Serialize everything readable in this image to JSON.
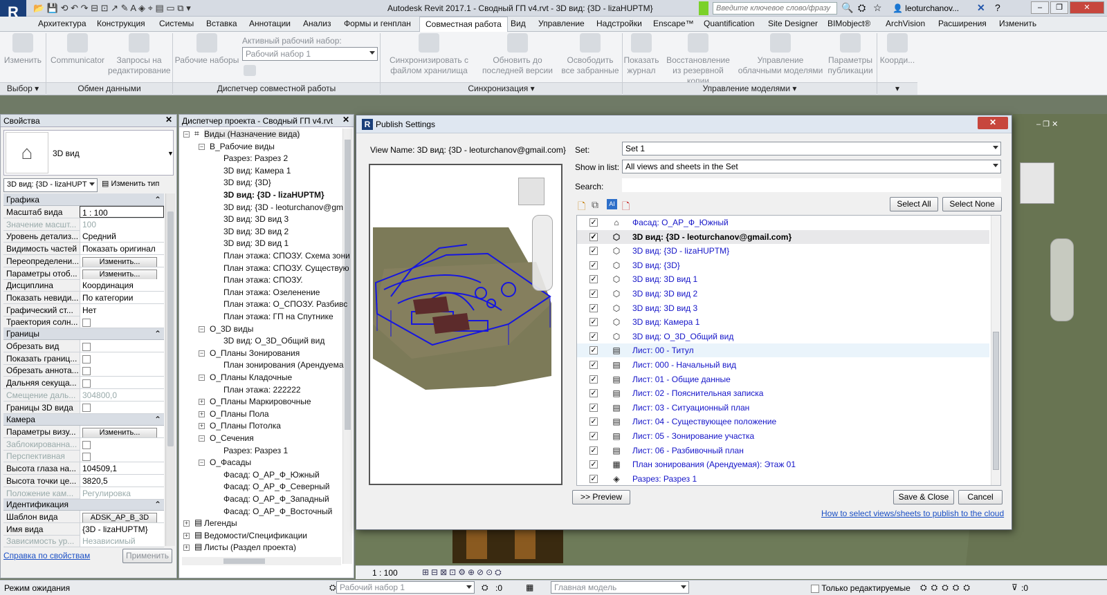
{
  "title_bar": {
    "logo": "R",
    "title": "Autodesk Revit 2017.1 -    Сводный ГП v4.rvt - 3D вид: {3D - lizaHUPTM}",
    "search_placeholder": "Введите ключевое слово/фразу",
    "user": "leoturchanov..."
  },
  "menu_tabs": [
    "Архитектура",
    "Конструкция",
    "Системы",
    "Вставка",
    "Аннотации",
    "Анализ",
    "Формы и генплан",
    "Совместная работа",
    "Вид",
    "Управление",
    "Надстройки",
    "Enscape™",
    "Quantification",
    "Site Designer",
    "BIMobject®",
    "ArchVision",
    "Расширения",
    "Изменить"
  ],
  "active_tab": "Совместная работа",
  "ribbon": {
    "modify": "Изменить",
    "communicator": "Communicator",
    "requests": "Запросы на редактирование",
    "worksets": "Рабочие наборы",
    "active_workset_label": "Активный рабочий набор:",
    "active_workset_value": "Рабочий набор 1",
    "sync": "Синхронизировать с файлом хранилища",
    "reload": "Обновить до последней версии",
    "relinquish": "Освободить все забранные",
    "show_log": "Показать журнал",
    "restore": "Восстановление из резервной копии",
    "cloud_models": "Управление облачными моделями",
    "publish_params": "Параметры публикации",
    "coord": "Коорди...",
    "panel_select": "Выбор",
    "panel_exchange": "Обмен данными",
    "panel_workset_mgr": "Диспетчер совместной работы",
    "panel_sync": "Синхронизация",
    "panel_models": "Управление моделями"
  },
  "properties": {
    "header": "Свойства",
    "type_name": "3D вид",
    "instance_select": "3D вид: {3D - lizaHUPT",
    "edit_type": "Изменить тип",
    "sections": {
      "graphics": "Графика",
      "extents": "Границы",
      "camera": "Камера",
      "identity": "Идентификация"
    },
    "rows_graphics": [
      {
        "k": "Масштаб вида",
        "v": "1 : 100"
      },
      {
        "k": "Значение масшт...",
        "v": "100"
      },
      {
        "k": "Уровень детализ...",
        "v": "Средний"
      },
      {
        "k": "Видимость частей",
        "v": "Показать оригинал"
      },
      {
        "k": "Переопределени...",
        "v": "Изменить..."
      },
      {
        "k": "Параметры отоб...",
        "v": "Изменить..."
      },
      {
        "k": "Дисциплина",
        "v": "Координация"
      },
      {
        "k": "Показать невиди...",
        "v": "По категории"
      },
      {
        "k": "Графический ст...",
        "v": "Нет"
      },
      {
        "k": "Траектория солн...",
        "v": ""
      }
    ],
    "rows_extents": [
      {
        "k": "Обрезать вид",
        "v": ""
      },
      {
        "k": "Показать границ...",
        "v": ""
      },
      {
        "k": "Обрезать аннота...",
        "v": ""
      },
      {
        "k": "Дальняя секуща...",
        "v": ""
      },
      {
        "k": "Смещение даль...",
        "v": "304800,0"
      },
      {
        "k": "Границы 3D вида",
        "v": ""
      }
    ],
    "rows_camera": [
      {
        "k": "Параметры визу...",
        "v": "Изменить..."
      },
      {
        "k": "Заблокированна...",
        "v": ""
      },
      {
        "k": "Перспективная",
        "v": ""
      },
      {
        "k": "Высота глаза на...",
        "v": "104509,1"
      },
      {
        "k": "Высота точки це...",
        "v": "3820,5"
      },
      {
        "k": "Положение кам...",
        "v": "Регулировка"
      }
    ],
    "rows_identity": [
      {
        "k": "Шаблон вида",
        "v": "ADSK_AP_B_3D"
      },
      {
        "k": "Имя вида",
        "v": "{3D - lizaHUPTM}"
      },
      {
        "k": "Зависимость ур...",
        "v": "Независимый"
      }
    ],
    "help_link": "Справка по свойствам",
    "apply": "Применить"
  },
  "browser": {
    "header": "Диспетчер проекта - Сводный ГП v4.rvt",
    "nodes": [
      {
        "t": "Виды (Назначение вида)",
        "lvl": 0,
        "exp": "-"
      },
      {
        "t": "В_Рабочие виды",
        "lvl": 1,
        "exp": "-"
      },
      {
        "t": "Разрез: Разрез 2",
        "lvl": 2
      },
      {
        "t": "3D вид: Камера 1",
        "lvl": 2
      },
      {
        "t": "3D вид: {3D}",
        "lvl": 2
      },
      {
        "t": "3D вид: {3D - lizaHUPTM}",
        "lvl": 2,
        "b": true
      },
      {
        "t": "3D вид: {3D - leoturchanov@gm",
        "lvl": 2
      },
      {
        "t": "3D вид: 3D вид 3",
        "lvl": 2
      },
      {
        "t": "3D вид: 3D вид 2",
        "lvl": 2
      },
      {
        "t": "3D вид: 3D вид 1",
        "lvl": 2
      },
      {
        "t": "План этажа: СПОЗУ. Схема зони",
        "lvl": 2
      },
      {
        "t": "План этажа: СПОЗУ. Существую",
        "lvl": 2
      },
      {
        "t": "План этажа: СПОЗУ.",
        "lvl": 2
      },
      {
        "t": "План этажа: Озеленение",
        "lvl": 2
      },
      {
        "t": "План этажа: О_СПОЗУ. Разбивс",
        "lvl": 2
      },
      {
        "t": "План этажа: ГП на Спутнике",
        "lvl": 2
      },
      {
        "t": "О_3D виды",
        "lvl": 1,
        "exp": "-"
      },
      {
        "t": "3D вид: О_3D_Общий вид",
        "lvl": 2
      },
      {
        "t": "О_Планы Зонирования",
        "lvl": 1,
        "exp": "-"
      },
      {
        "t": "План зонирования (Арендуема",
        "lvl": 2
      },
      {
        "t": "О_Планы Кладочные",
        "lvl": 1,
        "exp": "-"
      },
      {
        "t": "План этажа: 222222",
        "lvl": 2
      },
      {
        "t": "О_Планы Маркировочные",
        "lvl": 1,
        "exp": "+"
      },
      {
        "t": "О_Планы Пола",
        "lvl": 1,
        "exp": "+"
      },
      {
        "t": "О_Планы Потолка",
        "lvl": 1,
        "exp": "+"
      },
      {
        "t": "О_Сечения",
        "lvl": 1,
        "exp": "-"
      },
      {
        "t": "Разрез: Разрез 1",
        "lvl": 2
      },
      {
        "t": "О_Фасады",
        "lvl": 1,
        "exp": "-"
      },
      {
        "t": "Фасад: О_АР_Ф_Южный",
        "lvl": 2
      },
      {
        "t": "Фасад: О_АР_Ф_Северный",
        "lvl": 2
      },
      {
        "t": "Фасад: О_АР_Ф_Западный",
        "lvl": 2
      },
      {
        "t": "Фасад: О_АР_Ф_Восточный",
        "lvl": 2
      },
      {
        "t": "Легенды",
        "lvl": 0,
        "exp": "+"
      },
      {
        "t": "Ведомости/Спецификации",
        "lvl": 0,
        "exp": "+"
      },
      {
        "t": "Листы (Раздел проекта)",
        "lvl": 0,
        "exp": "+"
      }
    ]
  },
  "dialog": {
    "title": "Publish Settings",
    "view_name": "View Name: 3D вид: {3D - leoturchanov@gmail.com}",
    "set_label": "Set:",
    "set_value": "Set 1",
    "show_label": "Show in list:",
    "show_value": "All views and sheets in the Set",
    "search_label": "Search:",
    "select_all": "Select All",
    "select_none": "Select None",
    "preview": ">> Preview",
    "save_close": "Save & Close",
    "cancel": "Cancel",
    "help_link": "How to select views/sheets to publish to the cloud",
    "items": [
      {
        "t": "Фасад: О_АР_Ф_Южный",
        "icon": "elevation-icon"
      },
      {
        "t": "3D вид: {3D - leoturchanov@gmail.com}",
        "icon": "3d-view-icon",
        "sel": true
      },
      {
        "t": "3D вид: {3D - lizaHUPTM}",
        "icon": "3d-view-icon"
      },
      {
        "t": "3D вид: {3D}",
        "icon": "3d-view-icon"
      },
      {
        "t": "3D вид: 3D вид 1",
        "icon": "3d-view-icon"
      },
      {
        "t": "3D вид: 3D вид 2",
        "icon": "3d-view-icon"
      },
      {
        "t": "3D вид: 3D вид 3",
        "icon": "3d-view-icon"
      },
      {
        "t": "3D вид: Камера 1",
        "icon": "3d-view-icon"
      },
      {
        "t": "3D вид: О_3D_Общий вид",
        "icon": "3d-view-icon"
      },
      {
        "t": "Лист: 00 - Титул",
        "icon": "sheet-icon",
        "hov": true
      },
      {
        "t": "Лист: 000 - Начальный вид",
        "icon": "sheet-icon"
      },
      {
        "t": "Лист: 01 - Общие данные",
        "icon": "sheet-icon"
      },
      {
        "t": "Лист: 02 - Пояснительная записка",
        "icon": "sheet-icon"
      },
      {
        "t": "Лист: 03 - Ситуационный план",
        "icon": "sheet-icon"
      },
      {
        "t": "Лист: 04 - Существующее положение",
        "icon": "sheet-icon"
      },
      {
        "t": "Лист: 05 - Зонирование участка",
        "icon": "sheet-icon"
      },
      {
        "t": "Лист: 06 - Разбивочный план",
        "icon": "sheet-icon"
      },
      {
        "t": "План зонирования (Арендуемая): Этаж 01",
        "icon": "area-plan-icon"
      },
      {
        "t": "Разрез: Разрез 1",
        "icon": "section-icon"
      }
    ]
  },
  "view_controls": {
    "scale": "1 : 100"
  },
  "status_bar": {
    "state": "Режим ожидания",
    "workset": "Рабочий набор 1",
    "count_a": ":0",
    "model": "Главная модель",
    "editable_only": "Только редактируемые",
    "count_b": ":0"
  }
}
